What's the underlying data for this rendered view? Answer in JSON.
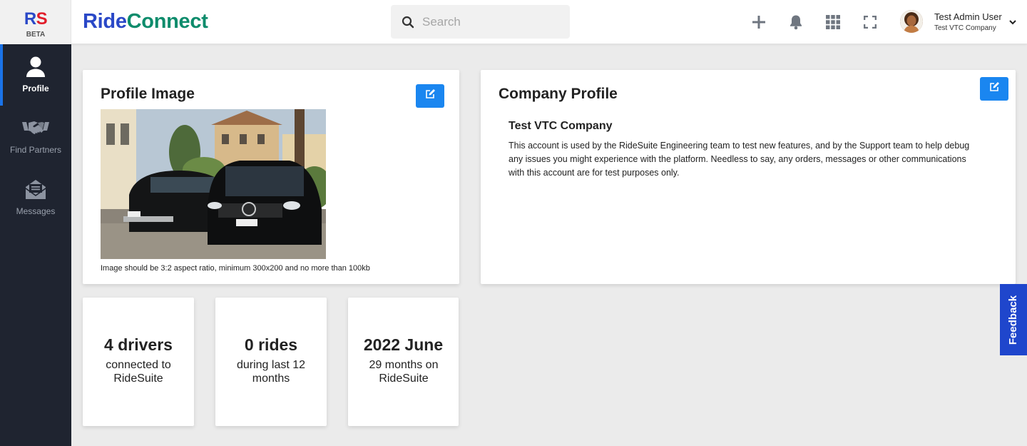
{
  "header": {
    "logo_letter_1": "R",
    "logo_letter_2": "S",
    "logo_badge": "BETA",
    "brand_part_1": "Ride",
    "brand_part_2": "Connect",
    "search_placeholder": "Search",
    "icons": [
      "plus-icon",
      "bell-icon",
      "apps-grid-icon",
      "fullscreen-icon"
    ],
    "user_name": "Test Admin User",
    "user_company": "Test VTC Company"
  },
  "sidebar": {
    "items": [
      {
        "label": "Profile",
        "icon": "user-icon",
        "active": true
      },
      {
        "label": "Find Partners",
        "icon": "handshake-icon",
        "active": false
      },
      {
        "label": "Messages",
        "icon": "envelope-icon",
        "active": false
      }
    ]
  },
  "profile_image_card": {
    "title": "Profile Image",
    "note": "Image should be 3:2 aspect ratio, minimum 300x200 and no more than 100kb"
  },
  "company_profile_card": {
    "title": "Company Profile",
    "company_name": "Test VTC Company",
    "description": "This account is used by the RideSuite Engineering team to test new features, and by the Support team to help debug any issues you might experience with the platform. Needless to say, any orders, messages or other communications with this account are for test purposes only."
  },
  "stats": [
    {
      "value": "4 drivers",
      "label": "connected to RideSuite"
    },
    {
      "value": "0 rides",
      "label": "during last 12 months"
    },
    {
      "value": "2022 June",
      "label": "29 months on RideSuite"
    }
  ],
  "feedback_label": "Feedback",
  "colors": {
    "brand_blue": "#2a48c7",
    "brand_green": "#0e8c6c",
    "logo_red": "#e11d2a",
    "sidebar_bg": "#1f2430",
    "edit_button": "#1a86f0",
    "feedback_tab": "#1f46cc"
  }
}
